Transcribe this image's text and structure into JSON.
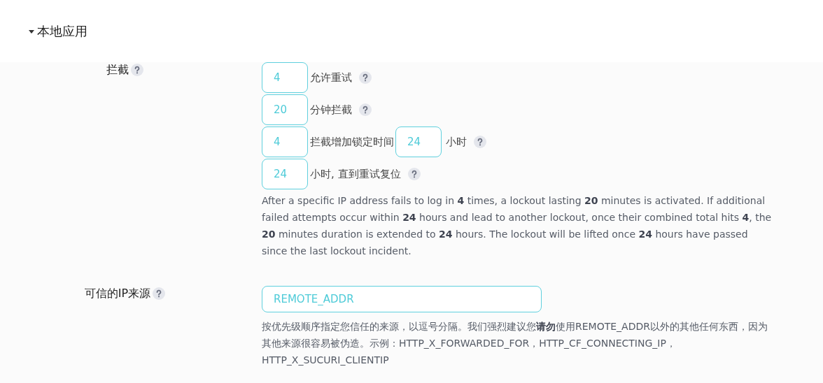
{
  "section": {
    "title": "本地应用",
    "expanded": true
  },
  "lockout": {
    "label": "拦截",
    "rows": [
      {
        "parts": [
          {
            "kind": "input",
            "value": "4"
          },
          {
            "kind": "text",
            "text": "允许重试"
          },
          {
            "kind": "help"
          }
        ]
      },
      {
        "parts": [
          {
            "kind": "input",
            "value": "20"
          },
          {
            "kind": "text",
            "text": "分钟拦截"
          },
          {
            "kind": "help"
          }
        ]
      },
      {
        "parts": [
          {
            "kind": "input",
            "value": "4"
          },
          {
            "kind": "text",
            "text": "拦截增加锁定时间"
          },
          {
            "kind": "input",
            "value": "24"
          },
          {
            "kind": "text",
            "text": "小时"
          },
          {
            "kind": "help"
          }
        ]
      },
      {
        "parts": [
          {
            "kind": "input",
            "value": "24"
          },
          {
            "kind": "text",
            "text": "小时, 直到重试复位"
          },
          {
            "kind": "help"
          }
        ]
      }
    ],
    "description": "After a specific IP address fails to log in **4** times, a lockout lasting **20** minutes is activated. If additional failed attempts occur within **24** hours and lead to another lockout, once their combined total hits **4**, the **20** minutes duration is extended to **24** hours. The lockout will be lifted once **24** hours have passed since the last lockout incident."
  },
  "trusted_ip": {
    "label": "可信的IP来源",
    "value": "REMOTE_ADDR",
    "description": "按优先级顺序指定您信任的来源，以逗号分隔。我们强烈建议您**请勿**使用REMOTE_ADDR以外的其他任何东西，因为其他来源很容易被伪造。示例：HTTP_X_FORWARDED_FOR，HTTP_CF_CONNECTING_IP，HTTP_X_SUCURI_CLIENTIP"
  }
}
